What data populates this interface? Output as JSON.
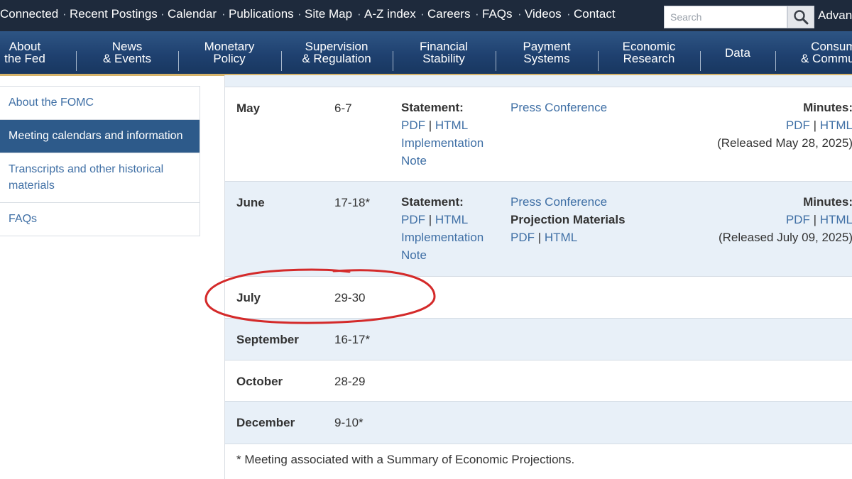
{
  "top_links": [
    "Connected",
    "Recent Postings",
    "Calendar",
    "Publications",
    "Site Map",
    "A-Z index",
    "Careers",
    "FAQs",
    "Videos",
    "Contact"
  ],
  "top_separator": "·",
  "search": {
    "placeholder": "Search",
    "icon": "search-icon"
  },
  "advanced_label": "Advanced",
  "nav": [
    {
      "label": "About\nthe Fed"
    },
    {
      "label": "News\n& Events"
    },
    {
      "label": "Monetary\nPolicy"
    },
    {
      "label": "Supervision\n& Regulation"
    },
    {
      "label": "Financial\nStability"
    },
    {
      "label": "Payment\nSystems"
    },
    {
      "label": "Economic\nResearch"
    },
    {
      "label": "Data"
    },
    {
      "label": "Consumers\n& Communities"
    }
  ],
  "sidebar": [
    {
      "label": "About the FOMC",
      "active": false
    },
    {
      "label": "Meeting calendars and information",
      "active": true
    },
    {
      "label": "Transcripts and other historical materials",
      "active": false
    },
    {
      "label": "FAQs",
      "active": false
    }
  ],
  "meetings": [
    {
      "month": "May",
      "dates": "6-7",
      "statement_label": "Statement:",
      "pdf": "PDF",
      "sep": "|",
      "html": "HTML",
      "impl_note_1": "Implementation",
      "impl_note_2": "Note",
      "press": "Press Conference",
      "minutes_label": "Minutes:",
      "minutes_pdf": "PDF",
      "minutes_html": "HTML",
      "released": "(Released May 28, 2025)"
    },
    {
      "month": "June",
      "dates": "17-18*",
      "statement_label": "Statement:",
      "pdf": "PDF",
      "sep": "|",
      "html": "HTML",
      "impl_note_1": "Implementation",
      "impl_note_2": "Note",
      "press": "Press Conference",
      "projection_label": "Projection Materials",
      "proj_pdf": "PDF",
      "proj_html": "HTML",
      "minutes_label": "Minutes:",
      "minutes_pdf": "PDF",
      "minutes_html": "HTML",
      "released": "(Released July 09, 2025)"
    },
    {
      "month": "July",
      "dates": "29-30"
    },
    {
      "month": "September",
      "dates": "16-17*"
    },
    {
      "month": "October",
      "dates": "28-29"
    },
    {
      "month": "December",
      "dates": "9-10*"
    }
  ],
  "footnote": "* Meeting associated with a Summary of Economic Projections.",
  "colors": {
    "topbar": "#1e2a3c",
    "nav": "#1f4170",
    "nav_accent": "#d5b36a",
    "link": "#3f6fa5",
    "active_sidebar": "#2d5a8a",
    "row_shade": "#e8f0f8",
    "annotation": "#d42a2a"
  }
}
